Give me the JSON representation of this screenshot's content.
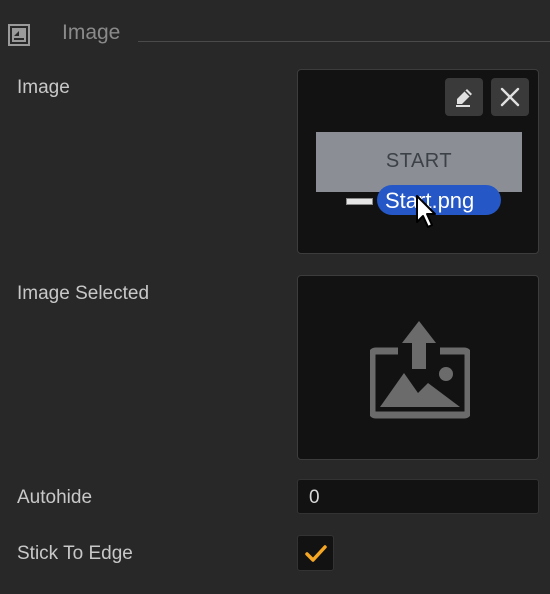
{
  "section": {
    "title": "Image",
    "icon": "image-section-icon"
  },
  "fields": {
    "image": {
      "label": "Image",
      "preview_text": "START",
      "drag_file_name": "Start.png",
      "edit_icon": "pencil-icon",
      "clear_icon": "close-icon"
    },
    "image_selected": {
      "label": "Image Selected",
      "icon": "upload-image-icon"
    },
    "autohide": {
      "label": "Autohide",
      "value": "0"
    },
    "stick_to_edge": {
      "label": "Stick To Edge",
      "checked": true
    }
  },
  "colors": {
    "background": "#282828",
    "field_background": "#121212",
    "pill": "#2557c7",
    "check": "#f5a623",
    "preview": "#8b8f95"
  }
}
